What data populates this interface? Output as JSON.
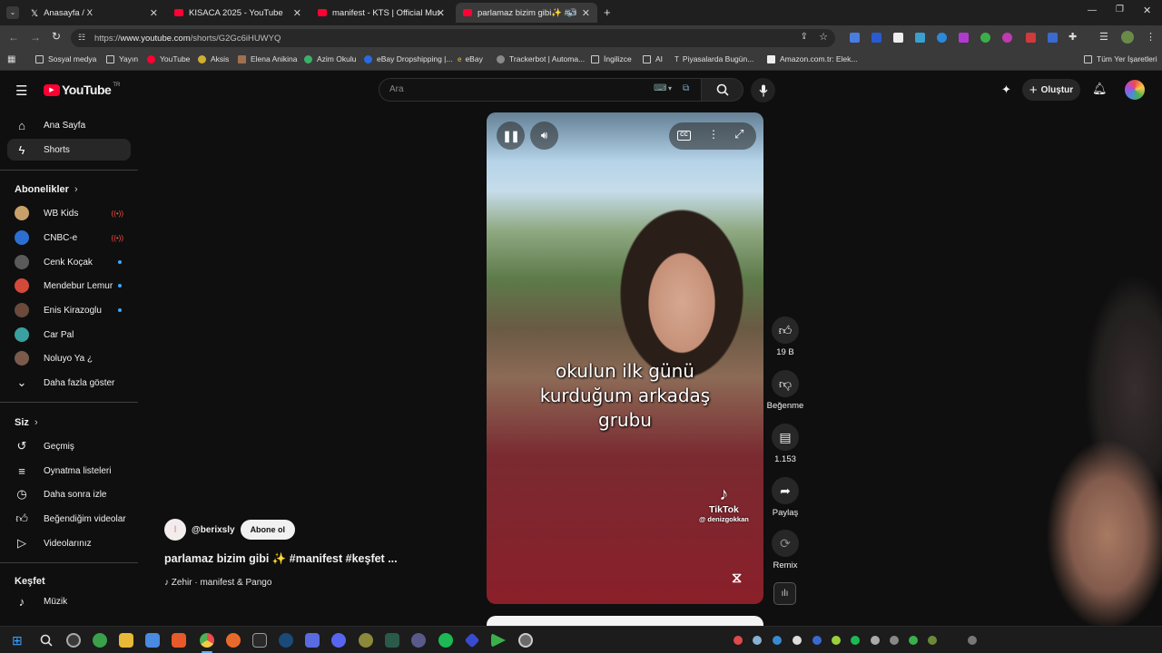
{
  "tabs": [
    {
      "title": "Anasayfa / X"
    },
    {
      "title": "KISACA 2025 - YouTube"
    },
    {
      "title": "manifest - KTS | Official Music V"
    },
    {
      "title": "parlamaz bizim gibi✨ #m"
    }
  ],
  "address": {
    "prefix": "https://",
    "host": "www.youtube.com",
    "path": "/shorts/G2Gc6iHUWYQ"
  },
  "bookmarks": [
    "Sosyal medya",
    "Yayın",
    "YouTube",
    "Aksis",
    "Elena Anikina",
    "Azim Okulu",
    "eBay Dropshipping |...",
    "eBay",
    "Trackerbot | Automa...",
    "İngilizce",
    "AI",
    "Piyasalarda Bugün...",
    "Amazon.com.tr: Elek...",
    "Tüm Yer İşaretleri"
  ],
  "header": {
    "logo": "YouTube",
    "logo_sup": "TR",
    "search_placeholder": "Ara",
    "create_label": "Oluştur"
  },
  "sidebar": {
    "main": [
      {
        "label": "Ana Sayfa",
        "icon": "home-icon"
      },
      {
        "label": "Shorts",
        "icon": "shorts-icon"
      }
    ],
    "subs_title": "Abonelikler",
    "subs": [
      {
        "label": "WB Kids",
        "badge": "((•))",
        "color": "#c8a06a"
      },
      {
        "label": "CNBC-e",
        "badge": "((•))",
        "color": "#2c6fd0"
      },
      {
        "label": "Cenk Koçak",
        "badge": "dot",
        "color": "#5a5a5a"
      },
      {
        "label": "Mendebur Lemur",
        "badge": "dot",
        "color": "#d24a3a"
      },
      {
        "label": "Enis Kirazoglu",
        "badge": "dot",
        "color": "#6a4a3a"
      },
      {
        "label": "Car Pal",
        "badge": "",
        "color": "#3aa0a0"
      },
      {
        "label": "Noluyo Ya ¿",
        "badge": "",
        "color": "#7a5a4a"
      }
    ],
    "more_label": "Daha fazla göster",
    "you_title": "Siz",
    "you": [
      {
        "label": "Geçmiş",
        "icon": "history-icon"
      },
      {
        "label": "Oynatma listeleri",
        "icon": "playlists-icon"
      },
      {
        "label": "Daha sonra izle",
        "icon": "watch-later-icon"
      },
      {
        "label": "Beğendiğim videolar",
        "icon": "liked-icon"
      },
      {
        "label": "Videolarınız",
        "icon": "your-videos-icon"
      }
    ],
    "explore_title": "Keşfet",
    "explore": [
      {
        "label": "Müzik",
        "icon": "music-icon"
      }
    ]
  },
  "short": {
    "channel": "@berixsly",
    "subscribe_label": "Abone ol",
    "title": "parlamaz bizim gibi ✨ #manifest #keşfet ...",
    "music": "♪ Zehir · manifest & Pango",
    "caption_lines": [
      "okulun ilk günü",
      "kurduğum arkadaş",
      "grubu"
    ],
    "watermark_brand": "TikTok",
    "watermark_user": "@ denizgokkan"
  },
  "actions": {
    "likes": "19 B",
    "dislike_label": "Beğenme",
    "comments": "1.153",
    "share_label": "Paylaş",
    "remix_label": "Remix"
  }
}
